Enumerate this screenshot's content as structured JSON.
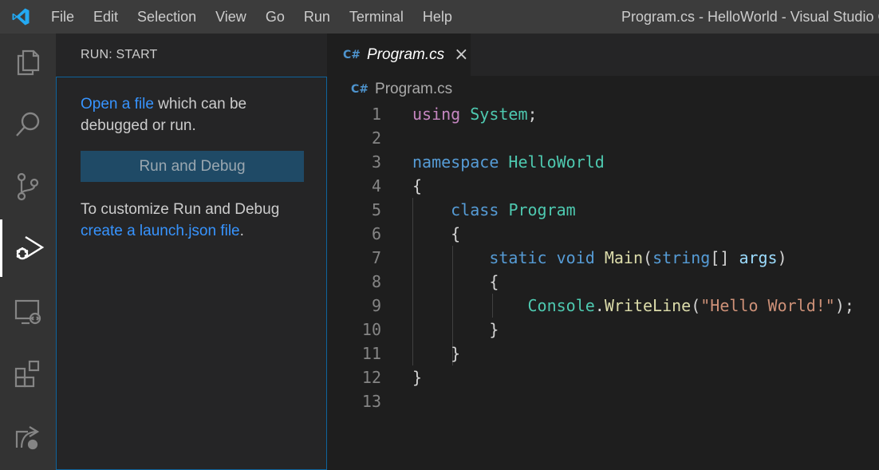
{
  "menu": [
    "File",
    "Edit",
    "Selection",
    "View",
    "Go",
    "Run",
    "Terminal",
    "Help"
  ],
  "window_title": "Program.cs - HelloWorld - Visual Studio C",
  "activity_bar": [
    {
      "name": "explorer-icon"
    },
    {
      "name": "search-icon"
    },
    {
      "name": "source-control-icon"
    },
    {
      "name": "run-debug-icon",
      "active": true
    },
    {
      "name": "remote-explorer-icon"
    },
    {
      "name": "extensions-icon"
    },
    {
      "name": "live-share-icon"
    }
  ],
  "sidebar": {
    "header": "RUN: START",
    "open_file_link": "Open a file",
    "open_file_rest": " which can be debugged or run.",
    "run_button": "Run and Debug",
    "customize_text": "To customize Run and Debug",
    "launch_link": "create a launch.json file",
    "launch_suffix": "."
  },
  "editor": {
    "tab_icon": "C#",
    "tab_label": "Program.cs",
    "tab_close": "×",
    "breadcrumb_icon": "C#",
    "breadcrumb": "Program.cs"
  },
  "code": {
    "line_numbers": [
      "1",
      "2",
      "3",
      "4",
      "5",
      "6",
      "7",
      "8",
      "9",
      "10",
      "11",
      "12",
      "13"
    ],
    "lines": [
      [
        {
          "t": "using",
          "c": "kw"
        },
        {
          "t": " ",
          "c": "pl"
        },
        {
          "t": "System",
          "c": "ty"
        },
        {
          "t": ";",
          "c": "pl"
        }
      ],
      [],
      [
        {
          "t": "namespace",
          "c": "kb"
        },
        {
          "t": " ",
          "c": "pl"
        },
        {
          "t": "HelloWorld",
          "c": "ty"
        }
      ],
      [
        {
          "t": "{",
          "c": "pl"
        }
      ],
      [
        {
          "t": "    ",
          "c": "pl"
        },
        {
          "t": "class",
          "c": "kb"
        },
        {
          "t": " ",
          "c": "pl"
        },
        {
          "t": "Program",
          "c": "ty"
        }
      ],
      [
        {
          "t": "    {",
          "c": "pl"
        }
      ],
      [
        {
          "t": "        ",
          "c": "pl"
        },
        {
          "t": "static",
          "c": "kb"
        },
        {
          "t": " ",
          "c": "pl"
        },
        {
          "t": "void",
          "c": "kb"
        },
        {
          "t": " ",
          "c": "pl"
        },
        {
          "t": "Main",
          "c": "fn"
        },
        {
          "t": "(",
          "c": "pl"
        },
        {
          "t": "string",
          "c": "kb"
        },
        {
          "t": "[] ",
          "c": "pl"
        },
        {
          "t": "args",
          "c": "pm"
        },
        {
          "t": ")",
          "c": "pl"
        }
      ],
      [
        {
          "t": "        {",
          "c": "pl"
        }
      ],
      [
        {
          "t": "            ",
          "c": "pl"
        },
        {
          "t": "Console",
          "c": "ty"
        },
        {
          "t": ".",
          "c": "pl"
        },
        {
          "t": "WriteLine",
          "c": "fn"
        },
        {
          "t": "(",
          "c": "pl"
        },
        {
          "t": "\"Hello World!\"",
          "c": "st"
        },
        {
          "t": ");",
          "c": "pl"
        }
      ],
      [
        {
          "t": "        }",
          "c": "pl"
        }
      ],
      [
        {
          "t": "    }",
          "c": "pl"
        }
      ],
      [
        {
          "t": "}",
          "c": "pl"
        }
      ],
      []
    ]
  },
  "colors": {
    "accent": "#0e639c",
    "link": "#3794ff",
    "title_bar": "#3c3c3c",
    "activity_bar": "#333333",
    "sidebar": "#252526",
    "editor": "#1e1e1e"
  }
}
